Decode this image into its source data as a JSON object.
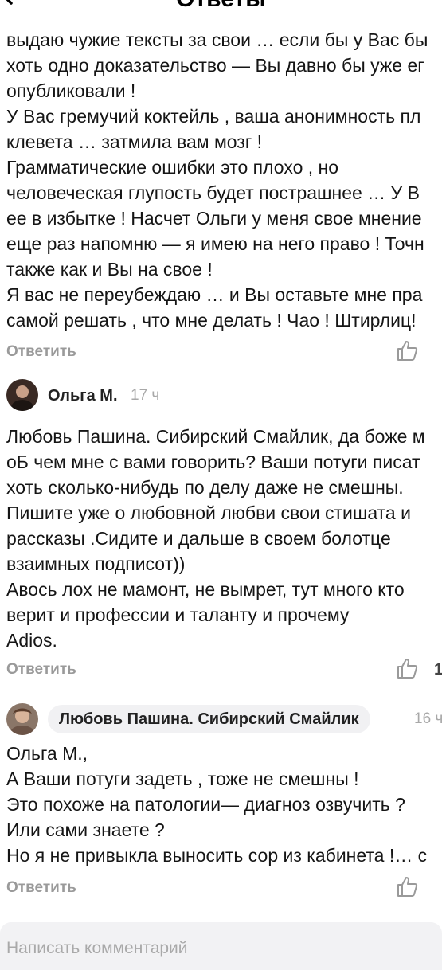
{
  "header": {
    "title": "Ответы"
  },
  "comments": [
    {
      "lines": [
        "выдаю чужие тексты за свои … если бы у Вас бы",
        "хоть одно доказательство — Вы давно бы уже ег",
        "опубликовали !",
        "У Вас гремучий коктейль , ваша анонимность пл",
        "клевета … затмила вам мозг !",
        "Грамматические ошибки это плохо , но",
        "человеческая глупость будет пострашнее … У В",
        "ее в избытке ! Насчет Ольги у меня свое мнение",
        "еще раз напомню — я имею на него право ! Точн",
        "также как и Вы на свое !",
        "Я вас не переубеждаю … и Вы оставьте мне пра",
        "самой решать , что мне делать ! Чао ! Штирлиц!"
      ],
      "reply_label": "Ответить"
    },
    {
      "author": "Ольга М.",
      "time": "17 ч",
      "lines": [
        "Любовь Пашина. Сибирский Смайлик, да боже м",
        "оБ чем мне с вами говорить? Ваши потуги писат",
        "хоть сколько-нибудь по делу даже не смешны.",
        "Пишите уже о любовной любви свои стишата и",
        "рассказы .Сидите и дальше в своем болотце",
        "взаимных подписот))",
        "Авось лох не мамонт, не вымрет, тут много кто",
        "верит и профессии и таланту и прочему",
        "Adios."
      ],
      "reply_label": "Ответить",
      "likes": "1"
    },
    {
      "author": "Любовь Пашина. Сибирский Смайлик",
      "time": "16 ч",
      "lines": [
        "Ольга М.,",
        "А Ваши потуги задеть , тоже не смешны !",
        "Это похоже на патологии— диагноз озвучить ?",
        "Или сами знаете ?",
        "Но я не привыкла выносить сор из кабинета !… с"
      ],
      "reply_label": "Ответить"
    }
  ],
  "composer": {
    "placeholder": "Написать комментарий"
  },
  "icons": {
    "like": "thumbs-up-icon",
    "back": "back-arrow-icon"
  }
}
